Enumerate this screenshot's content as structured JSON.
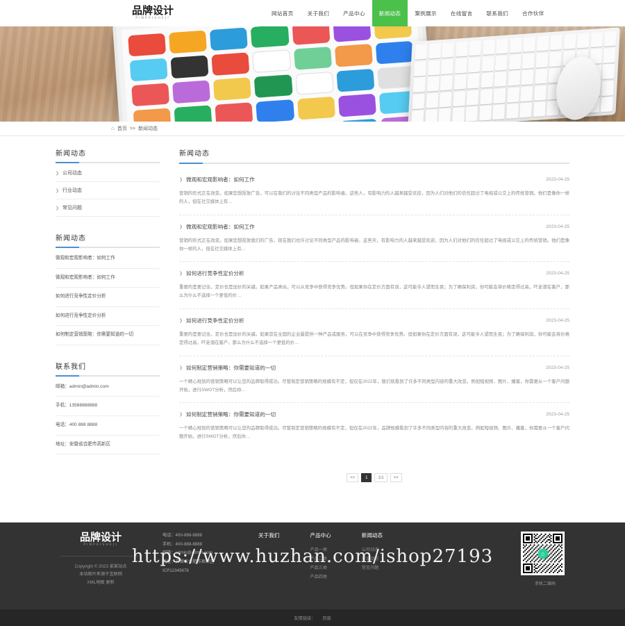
{
  "site": {
    "logo_cn": "品牌设计",
    "logo_en": "PINPAISHEJI"
  },
  "nav": {
    "items": [
      {
        "label": "网站首页",
        "active": false
      },
      {
        "label": "关于我们",
        "active": false
      },
      {
        "label": "产品中心",
        "active": false
      },
      {
        "label": "新闻动态",
        "active": true
      },
      {
        "label": "案例展示",
        "active": false
      },
      {
        "label": "在线留言",
        "active": false
      },
      {
        "label": "联系我们",
        "active": false
      },
      {
        "label": "合作伙伴",
        "active": false
      }
    ]
  },
  "breadcrumb": {
    "home_icon": "home-icon",
    "home": "首页",
    "separator": ">>",
    "current": "新闻动态"
  },
  "sidebar": {
    "category": {
      "title": "新闻动态",
      "items": [
        {
          "label": "公司动态"
        },
        {
          "label": "行业动态"
        },
        {
          "label": "常见问题"
        }
      ]
    },
    "news": {
      "title": "新闻动态",
      "items": [
        {
          "label": "微观和宏观影响者：如何工作"
        },
        {
          "label": "微观和宏观影响者：如何工作"
        },
        {
          "label": "如何进行竞争性定价分析"
        },
        {
          "label": "如何进行竞争性定价分析"
        },
        {
          "label": "如何制定营销策略：你需要知道的一切"
        }
      ]
    },
    "contact": {
      "title": "联系我们",
      "items": [
        {
          "label": "邮箱：admin@admin.com"
        },
        {
          "label": "手机：13588888888"
        },
        {
          "label": "电话：400 888 8888"
        },
        {
          "label": "地址：安徽省合肥市高新区"
        }
      ]
    }
  },
  "content": {
    "title": "新闻动态",
    "articles": [
      {
        "title": "微观和宏观影响者：如何工作",
        "date": "2023-04-25",
        "desc": "营销的形式正在改变。如果您想投放广告，可以在我们的讨论不同类型产品的影响者。这些人，有影响力的人越来越受欢迎，因为人们对他们的信任超过了电视或公交上的传统营销。他们是像你一样的人，但在社交媒体上有…"
      },
      {
        "title": "微观和宏观影响者：如何工作",
        "date": "2023-04-25",
        "desc": "营销的形式正在改变。如果您想投放我们的广告，现在我们也许讨论不同类型产品的影响者。这些天，有影响力的人越来越受欢迎，因为人们对他们的信任超过了电视或公交上的传统营销。他们是像你一样的人，但在社交媒体上有…"
      },
      {
        "title": "如何进行竞争性定价分析",
        "date": "2023-04-25",
        "desc": "重要的是要记住，定价也是加价的关键。如果产品类似，可以从竞争中获得竞争优势。但如果你在定价方面有误，这可能令人望而生畏；为了确保利润，你可能会将价格定得过高，吓走潜在客户，那么为什么不选择一个更低的价…"
      },
      {
        "title": "如何进行竞争性定价分析",
        "date": "2023-04-25",
        "desc": "重要的是要记住，定价也是加价的关键。如果您在全国的企业最提供一种产品或服务，可以在竞争中获得竞争优势。但如果你在定价方面有误，这可能令人望而生畏；为了确保利润，你可能会将价格定得过高，吓走潜在客户，那么为什么不选择一个更低的价…"
      },
      {
        "title": "如何制定营销策略：你需要知道的一切",
        "date": "2023-04-25",
        "desc": "一个精心规划的营销策略可以让您的品牌取得成功。尽管制定营销策略的规模有不定，但仅在2022年，我们就看到了许多不同类型内容的重大改变。例如短视频、图片、播客，你需要从一个客户问题开始，进行SWOT分析，然后你…"
      },
      {
        "title": "如何制定营销策略：你需要知道的一切",
        "date": "2023-04-25",
        "desc": "一个精心规划的营销策略可以让您的品牌取得成功。尽管制定营销策略的规模有不定，但仅在2022年，品牌规模看到了许多不同类型内容的重大改变。例如短视频、图片、播客，你需要从一个客户问题开始，进行SWOT分析，然后你…"
      }
    ],
    "pagination": {
      "prev": "<<",
      "pages": [
        "1"
      ],
      "info": "1/1",
      "next": ">>"
    }
  },
  "footer": {
    "logo_cn": "品牌设计",
    "logo_en": "PINPAISHEJI",
    "copyright": [
      "Copyright © 2023 某某站点",
      "本站图片来源于互联网",
      "XML地图 更新"
    ],
    "contact": [
      "电话：400-888-8888",
      "手机：400-888-8888",
      "邮箱：admin@admin.com",
      "地址：安徽省合肥市高新区",
      "ICP12345678"
    ],
    "columns": [
      {
        "title": "关于我们",
        "items": []
      },
      {
        "title": "产品中心",
        "items": [
          {
            "label": "产品一类"
          },
          {
            "label": "产品二类"
          },
          {
            "label": "产品三类"
          },
          {
            "label": "产品四类"
          }
        ]
      },
      {
        "title": "新闻动态",
        "items": [
          {
            "label": "公司动态"
          },
          {
            "label": "行业动态"
          },
          {
            "label": "常见问题"
          }
        ]
      }
    ],
    "qr_caption": "手机二维码",
    "qr_center_icon": "home-icon"
  },
  "bottombar": {
    "links_label": "友情链接：",
    "links": [
      {
        "label": "百度"
      }
    ]
  },
  "watermark": {
    "text": "https://www.huzhan.com/ishop27193"
  },
  "colors": {
    "accent_green": "#4bc14b",
    "accent_blue": "#4a8fd4",
    "footer_bg": "#333333",
    "bottombar_bg": "#262626"
  }
}
